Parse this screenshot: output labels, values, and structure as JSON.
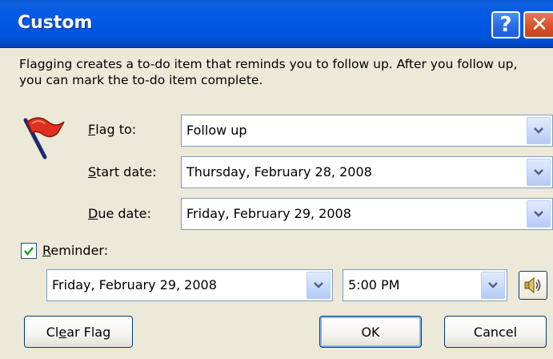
{
  "window": {
    "title": "Custom",
    "help_label": "?",
    "close_label": "✕"
  },
  "description": "Flagging creates a to-do item that reminds you to follow up. After you follow up, you can mark the to-do item complete.",
  "fields": {
    "flag_to": {
      "label_ul": "F",
      "label_rest": "lag to:",
      "value": "Follow up"
    },
    "start_date": {
      "label_ul": "S",
      "label_rest": "tart date:",
      "value": "Thursday, February 28, 2008"
    },
    "due_date": {
      "label_ul": "D",
      "label_rest": "ue date:",
      "value": "Friday, February 29, 2008"
    }
  },
  "reminder": {
    "checked": true,
    "label_ul": "R",
    "label_rest": "eminder:",
    "date_value": "Friday, February 29, 2008",
    "time_value": "5:00 PM"
  },
  "buttons": {
    "clear_flag_pre": "Cl",
    "clear_flag_ul": "e",
    "clear_flag_post": "ar Flag",
    "ok": "OK",
    "cancel": "Cancel"
  },
  "icons": {
    "flag": "red-flag-icon",
    "dropdown": "chevron-down-icon",
    "speaker": "speaker-icon",
    "check": "checkmark-icon"
  },
  "colors": {
    "titlebar": "#0054e3",
    "dialog_bg": "#ece9d8",
    "close_button": "#d9562e",
    "flag": "#e03020"
  }
}
